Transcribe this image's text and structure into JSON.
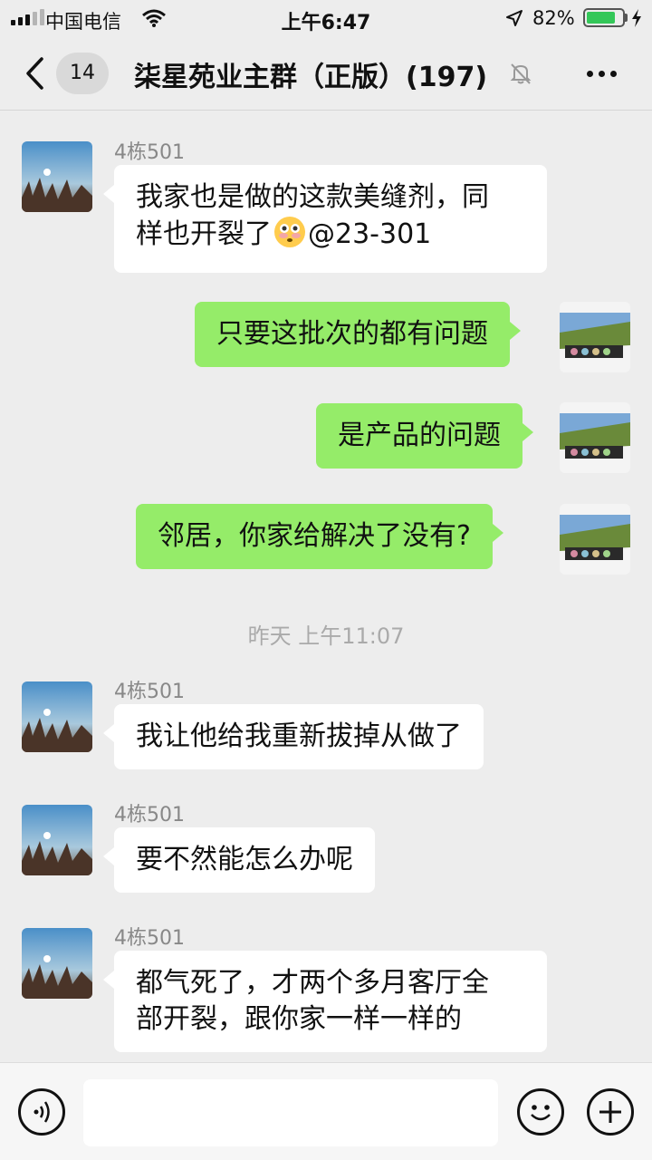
{
  "status_bar": {
    "carrier": "中国电信",
    "time": "上午6:47",
    "battery": "82%",
    "battery_level": 0.82
  },
  "nav": {
    "back_icon": "chevron-left-icon",
    "unread_count": "14",
    "title": "柒星苑业主群（正版）(197)",
    "mute_icon": "bell-slash-icon",
    "more_icon": "ellipsis-icon"
  },
  "messages": [
    {
      "direction": "in",
      "sender": "4栋501",
      "text": "我家也是做的这款美缝剂，同",
      "text2": "样也开裂了",
      "emoji": "flushed-face-icon",
      "text3": "@23-301"
    },
    {
      "direction": "out",
      "text": "只要这批次的都有问题"
    },
    {
      "direction": "out",
      "text": "是产品的问题"
    },
    {
      "direction": "out",
      "text": "邻居，你家给解决了没有?"
    },
    {
      "direction": "in",
      "sender": "4栋501",
      "text": "我让他给我重新拔掉从做了"
    },
    {
      "direction": "in",
      "sender": "4栋501",
      "text": "要不然能怎么办呢"
    },
    {
      "direction": "in",
      "sender": "4栋501",
      "text": "都气死了，才两个多月客厅全",
      "text2": "部开裂，跟你家一样一样的"
    }
  ],
  "timestamp": "昨天 上午11:07",
  "input_bar": {
    "voice_icon": "voice-icon",
    "input_value": "",
    "emoji_icon": "smiley-icon",
    "plus_icon": "plus-icon"
  },
  "colors": {
    "background": "#ededed",
    "outgoing_bubble": "#95ec69",
    "incoming_bubble": "#ffffff",
    "battery": "#34c759"
  }
}
